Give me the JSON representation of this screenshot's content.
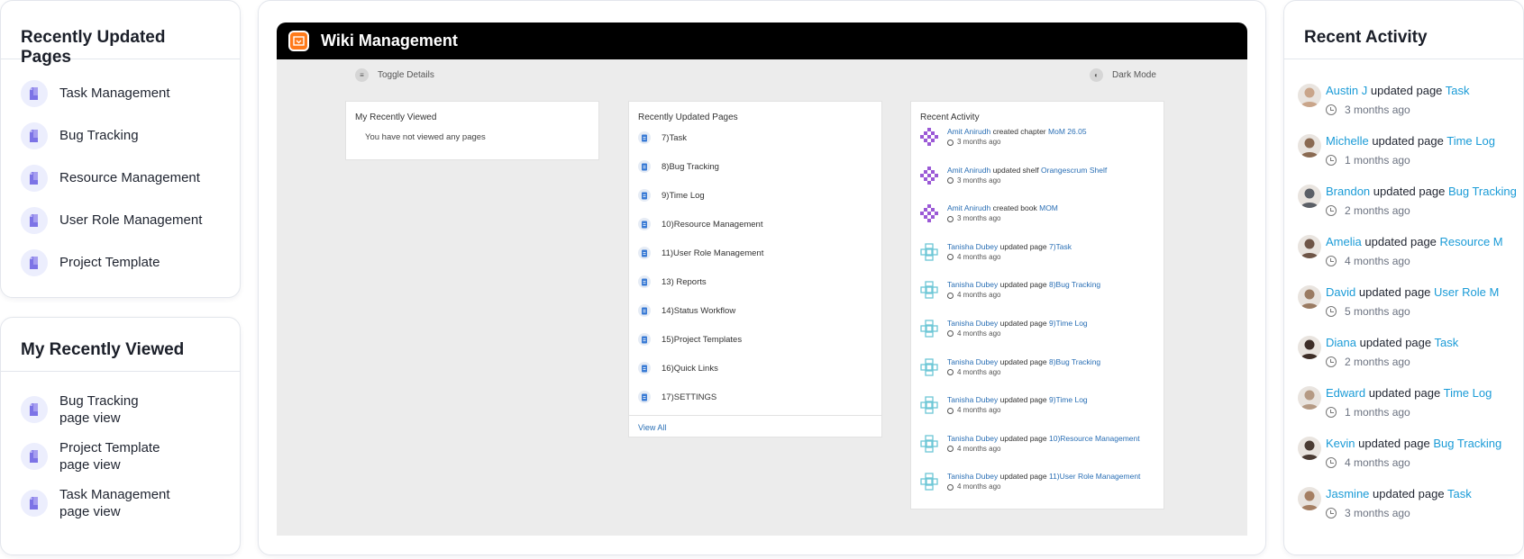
{
  "recently_updated": {
    "title": "Recently Updated Pages",
    "items": [
      "Task Management",
      "Bug Tracking",
      "Resource Management",
      "User Role Management",
      "Project Template"
    ]
  },
  "recently_viewed": {
    "title": "My Recently Viewed",
    "items": [
      {
        "name": "Bug Tracking",
        "sub": "page view"
      },
      {
        "name": "Project Template",
        "sub": "page view"
      },
      {
        "name": "Task Management",
        "sub": "page view"
      }
    ]
  },
  "app": {
    "title": "Wiki Management",
    "toggle_details": "Toggle Details",
    "dark_mode": "Dark Mode",
    "my_recently_viewed": {
      "title": "My Recently Viewed",
      "empty": "You have not viewed any pages"
    },
    "recently_updated": {
      "title": "Recently Updated Pages",
      "items": [
        "7)Task",
        "8)Bug Tracking",
        "9)Time Log",
        "10)Resource Management",
        "11)User Role Management",
        "13) Reports",
        "14)Status Workflow",
        "15)Project Templates",
        "16)Quick Links",
        "17)SETTINGS"
      ],
      "view_all": "View All"
    },
    "recent_activity": {
      "title": "Recent Activity",
      "items": [
        {
          "user": "Amit Anirudh",
          "action": "created chapter",
          "target": "MoM 26.05",
          "time": "3 months ago",
          "avatar": "purple"
        },
        {
          "user": "Amit Anirudh",
          "action": "updated shelf",
          "target": "Orangescrum Shelf",
          "time": "3 months ago",
          "avatar": "purple"
        },
        {
          "user": "Amit Anirudh",
          "action": "created book",
          "target": "MOM",
          "time": "3 months ago",
          "avatar": "purple"
        },
        {
          "user": "Tanisha Dubey",
          "action": "updated page",
          "target": "7)Task",
          "time": "4 months ago",
          "avatar": "teal"
        },
        {
          "user": "Tanisha Dubey",
          "action": "updated page",
          "target": "8)Bug Tracking",
          "time": "4 months ago",
          "avatar": "teal"
        },
        {
          "user": "Tanisha Dubey",
          "action": "updated page",
          "target": "9)Time Log",
          "time": "4 months ago",
          "avatar": "teal"
        },
        {
          "user": "Tanisha Dubey",
          "action": "updated page",
          "target": "8)Bug Tracking",
          "time": "4 months ago",
          "avatar": "teal"
        },
        {
          "user": "Tanisha Dubey",
          "action": "updated page",
          "target": "9)Time Log",
          "time": "4 months ago",
          "avatar": "teal"
        },
        {
          "user": "Tanisha Dubey",
          "action": "updated page",
          "target": "10)Resource Management",
          "time": "4 months ago",
          "avatar": "teal"
        },
        {
          "user": "Tanisha Dubey",
          "action": "updated page",
          "target": "11)User Role Management",
          "time": "4 months ago",
          "avatar": "teal"
        }
      ]
    }
  },
  "recent_activity": {
    "title": "Recent Activity",
    "items": [
      {
        "user": "Austin J",
        "action": "updated page",
        "target": "Task",
        "time": "3 months ago",
        "avatar_color": "#c9a58a"
      },
      {
        "user": "Michelle",
        "action": "updated page",
        "target": "Time Log",
        "time": "1 months ago",
        "avatar_color": "#8a6a52"
      },
      {
        "user": "Brandon",
        "action": "updated page",
        "target": "Bug Tracking",
        "time": "2 months ago",
        "avatar_color": "#5b5f66"
      },
      {
        "user": "Amelia",
        "action": "updated page",
        "target": "Resource M",
        "time": "4 months ago",
        "avatar_color": "#6e5547"
      },
      {
        "user": "David",
        "action": "updated page",
        "target": "User Role M",
        "time": "5 months ago",
        "avatar_color": "#9a7b62"
      },
      {
        "user": "Diana",
        "action": "updated page",
        "target": "Task",
        "time": "2 months ago",
        "avatar_color": "#3d2d27"
      },
      {
        "user": "Edward",
        "action": "updated page",
        "target": "Time Log",
        "time": "1 months ago",
        "avatar_color": "#b59a84"
      },
      {
        "user": "Kevin",
        "action": "updated page",
        "target": "Bug Tracking",
        "time": "4 months ago",
        "avatar_color": "#4a3b33"
      },
      {
        "user": "Jasmine",
        "action": "updated page",
        "target": "Task",
        "time": "3 months ago",
        "avatar_color": "#a57f63"
      }
    ]
  }
}
